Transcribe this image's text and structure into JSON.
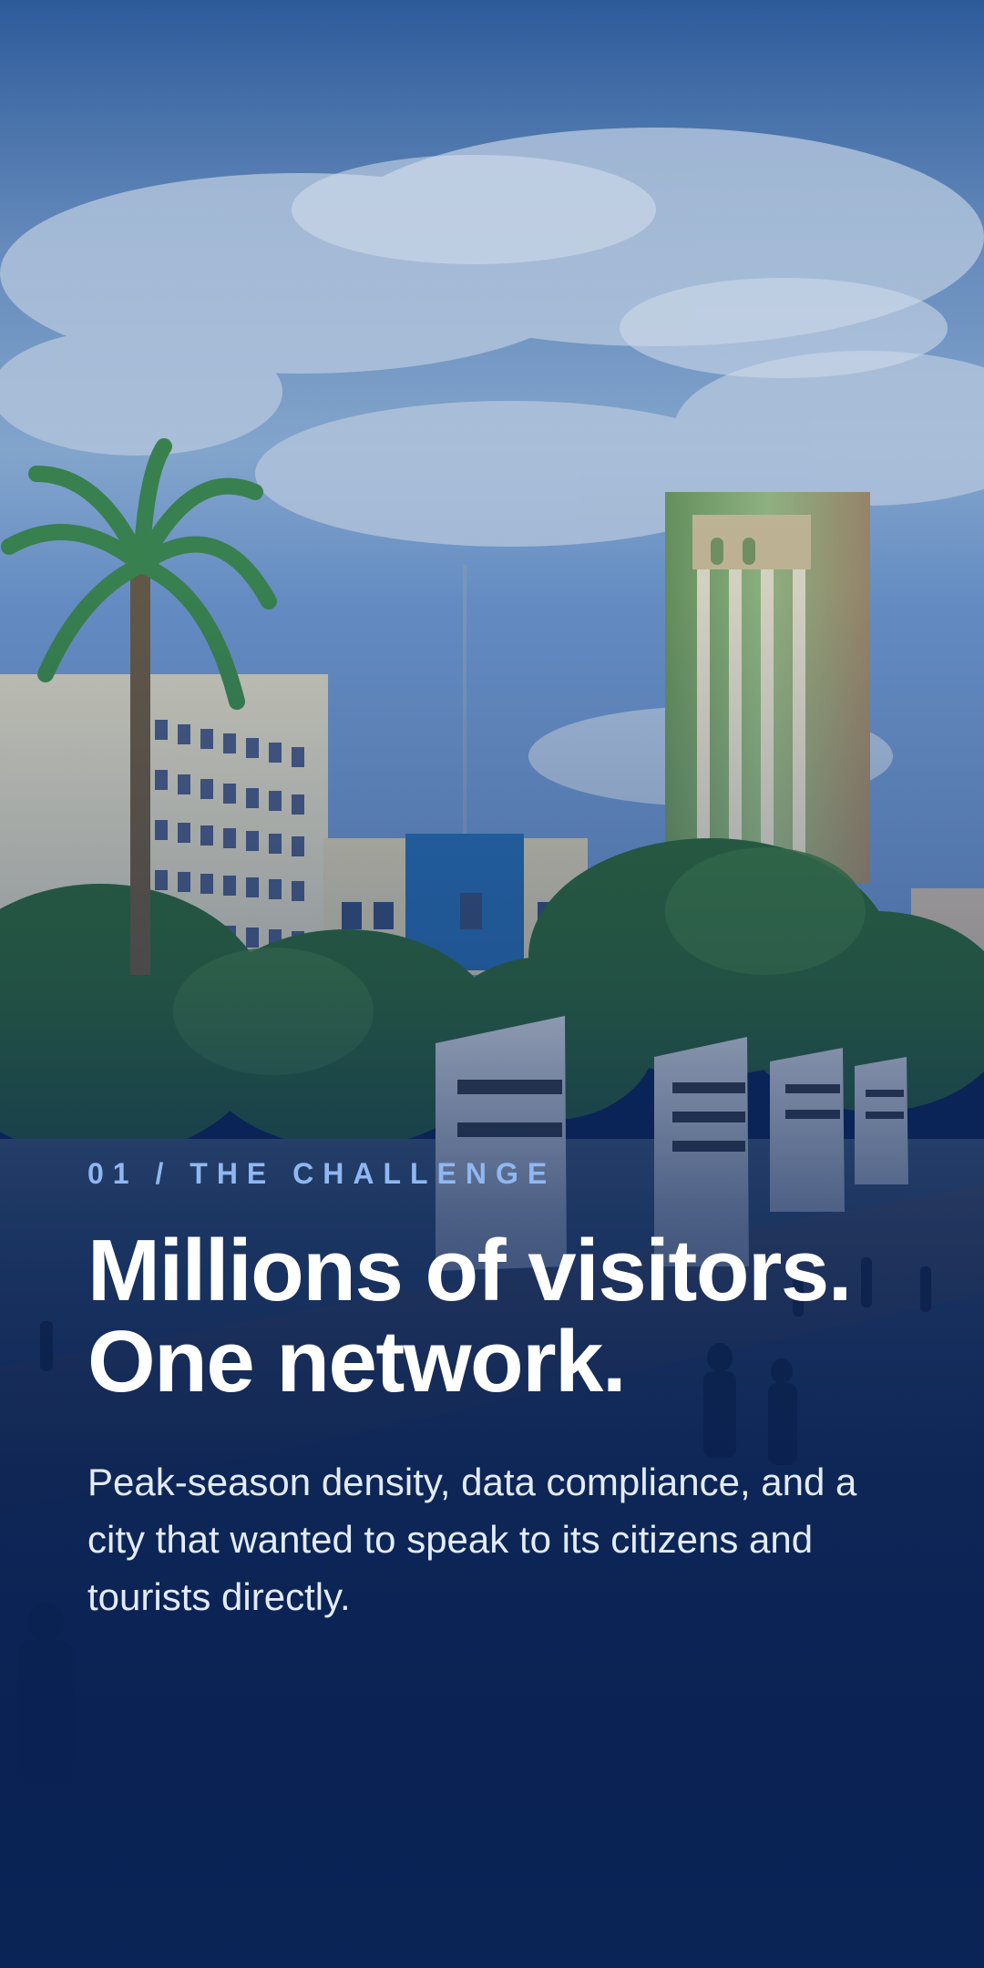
{
  "slide": {
    "eyebrow": "01 / THE CHALLENGE",
    "headline_line1": "Millions of visitors.",
    "headline_line2": "One network.",
    "body": "Peak-season density, data compliance, and a city that wanted to speak to its citizens and tourists directly."
  },
  "colors": {
    "eyebrow": "#8fb8f2",
    "headline": "#ffffff",
    "body": "#e3ebf8",
    "overlay_base": "#0a2457"
  }
}
